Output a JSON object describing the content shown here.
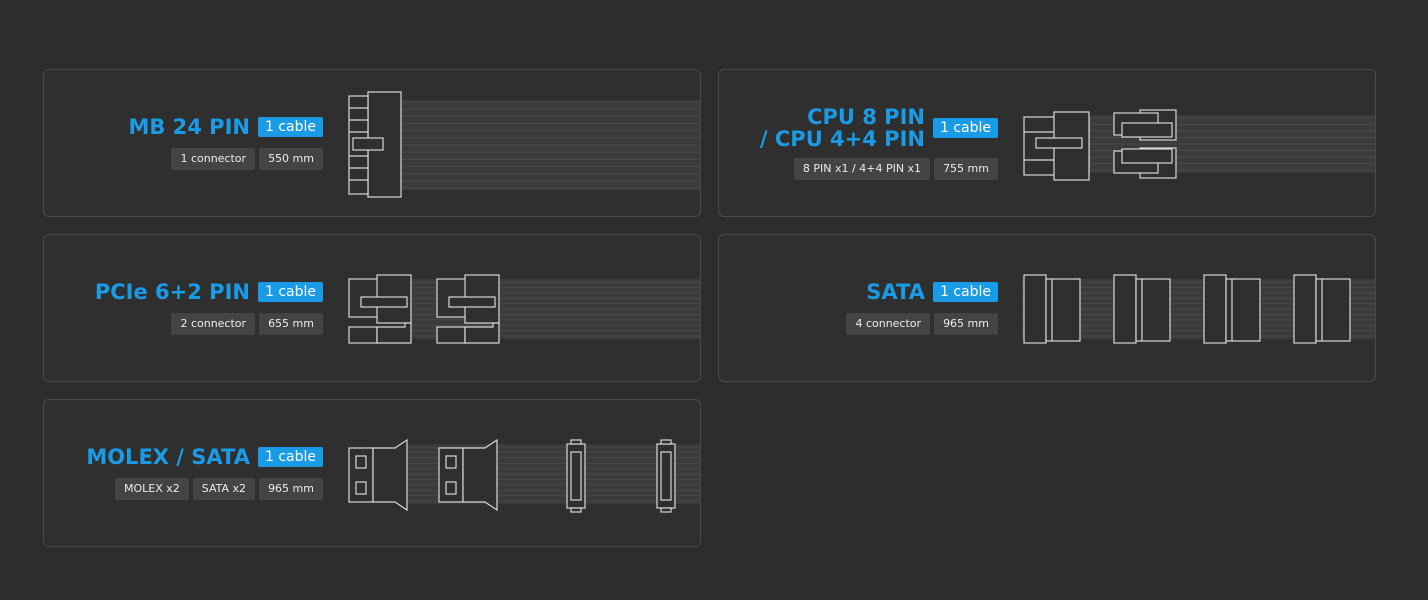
{
  "cables": [
    {
      "id": "mb24",
      "title": "MB 24 PIN",
      "badge": "1 cable",
      "tags": [
        "1 connector",
        "550 mm"
      ]
    },
    {
      "id": "cpu8",
      "title": "CPU 8 PIN\n/ CPU 4+4 PIN",
      "badge": "1 cable",
      "tags": [
        "8 PIN x1 / 4+4 PIN x1",
        "755 mm"
      ]
    },
    {
      "id": "pcie",
      "title": "PCIe 6+2 PIN",
      "badge": "1 cable",
      "tags": [
        "2 connector",
        "655 mm"
      ]
    },
    {
      "id": "sata",
      "title": "SATA",
      "badge": "1 cable",
      "tags": [
        "4 connector",
        "965 mm"
      ]
    },
    {
      "id": "molex",
      "title": "MOLEX / SATA",
      "badge": "1 cable",
      "tags": [
        "MOLEX x2",
        "SATA x2",
        "965 mm"
      ]
    }
  ],
  "colors": {
    "accent": "#1a9be6",
    "card_bg": "#2f2f2f",
    "tag_bg": "#444444",
    "line": "#d0d0d0"
  }
}
